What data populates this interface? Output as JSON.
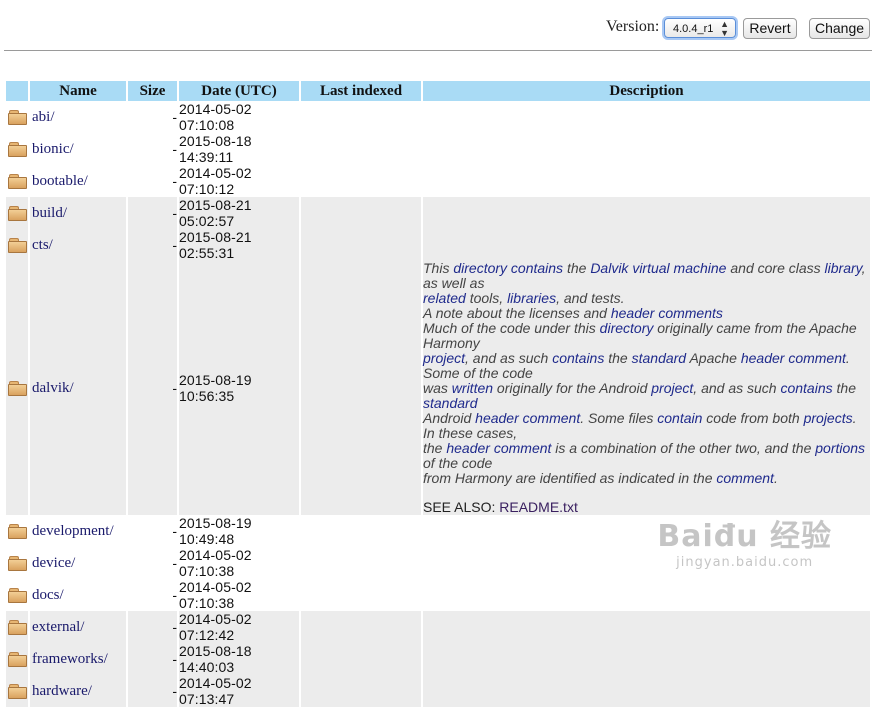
{
  "header": {
    "version_label": "Version:",
    "version_value": "4.0.4_r1",
    "revert_label": "Revert",
    "change_label": "Change"
  },
  "table": {
    "columns": [
      "Name",
      "Size",
      "Date (UTC)",
      "Last indexed",
      "Description"
    ],
    "rows": [
      {
        "name": "abi/",
        "size": "-",
        "date": "2014-05-02 07:10:08"
      },
      {
        "name": "bionic/",
        "size": "-",
        "date": "2015-08-18 14:39:11"
      },
      {
        "name": "bootable/",
        "size": "-",
        "date": "2014-05-02 07:10:12"
      },
      {
        "name": "build/",
        "size": "-",
        "date": "2015-08-21 05:02:57"
      },
      {
        "name": "cts/",
        "size": "-",
        "date": "2015-08-21 02:55:31"
      },
      {
        "name": "dalvik/",
        "size": "-",
        "date": "2015-08-19 10:56:35"
      },
      {
        "name": "development/",
        "size": "-",
        "date": "2015-08-19 10:49:48"
      },
      {
        "name": "device/",
        "size": "-",
        "date": "2014-05-02 07:10:38"
      },
      {
        "name": "docs/",
        "size": "-",
        "date": "2014-05-02 07:10:38"
      },
      {
        "name": "external/",
        "size": "-",
        "date": "2014-05-02 07:12:42"
      },
      {
        "name": "frameworks/",
        "size": "-",
        "date": "2015-08-18 14:40:03"
      },
      {
        "name": "hardware/",
        "size": "-",
        "date": "2014-05-02 07:13:47"
      }
    ]
  },
  "dalvik_desc": {
    "l1": [
      "This ",
      "directory contains",
      " the ",
      "Dalvik virtual machine",
      " and core class ",
      "library",
      ", as well as"
    ],
    "l2": [
      "related",
      " tools, ",
      "libraries",
      ", and tests."
    ],
    "l3": [
      "A note about the licenses and ",
      "header comments"
    ],
    "l4": [
      "Much of the code under this ",
      "directory",
      " originally came from the Apache Harmony"
    ],
    "l5": [
      "project",
      ", and as such ",
      "contains",
      " the ",
      "standard",
      " Apache ",
      "header comment",
      ". Some of the code"
    ],
    "l6": [
      "was ",
      "written",
      " originally for the Android ",
      "project",
      ", and as such ",
      "contains",
      " the ",
      "standard"
    ],
    "l7": [
      "Android ",
      "header comment",
      ". Some files ",
      "contain",
      " code from both ",
      "projects",
      ". In these cases,"
    ],
    "l8": [
      "the ",
      "header comment",
      " is a combination of the other two, and the ",
      "portions",
      " of the code"
    ],
    "l9": [
      "from Harmony are identified as indicated in the ",
      "comment",
      "."
    ],
    "see_also": "SEE ALSO: ",
    "readme": "README.txt"
  },
  "watermark": {
    "line1": "Baiđu 经验",
    "line2": "jingyan.baidu.com"
  }
}
